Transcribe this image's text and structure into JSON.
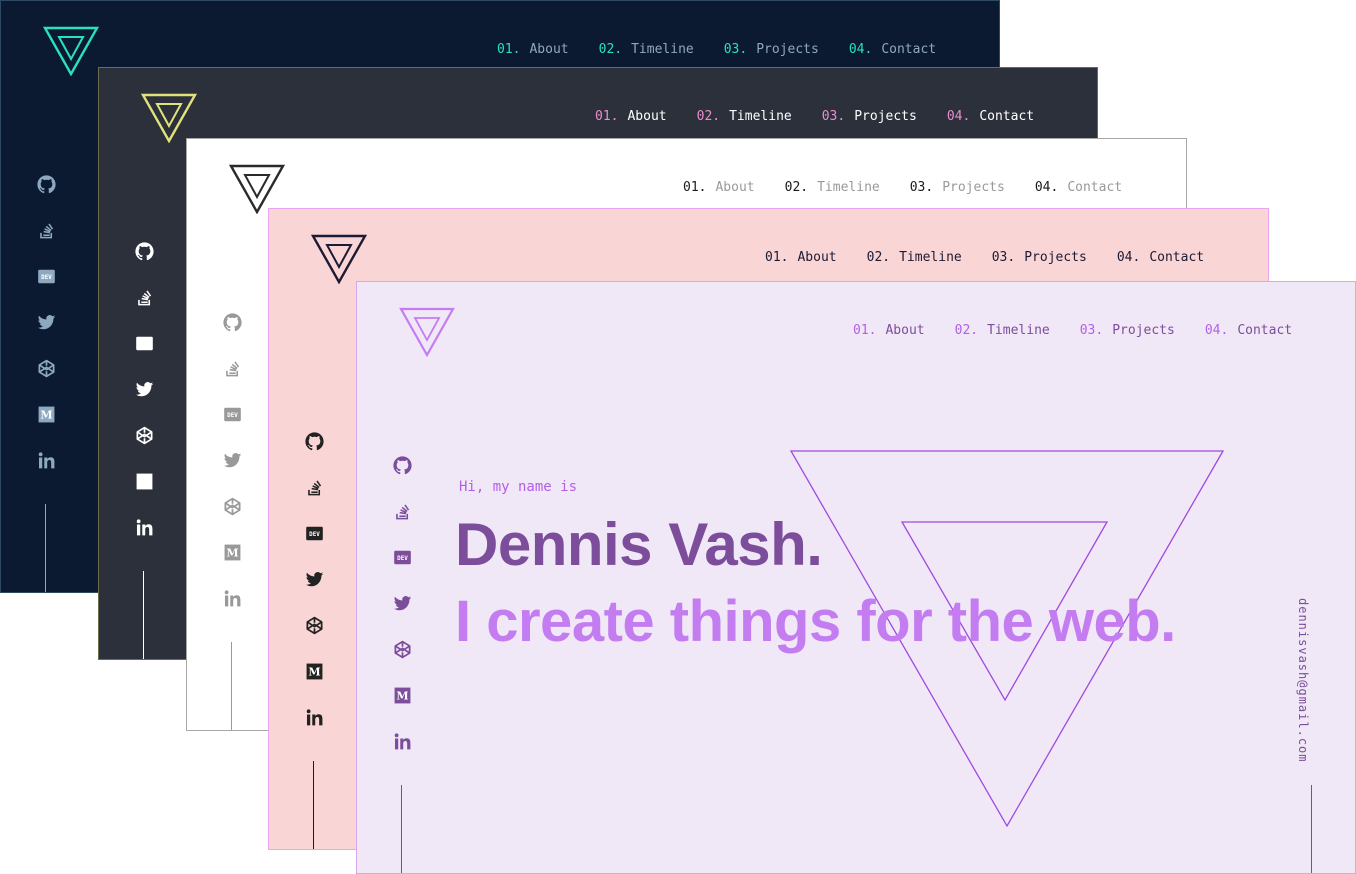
{
  "nav": [
    {
      "num": "01.",
      "label": "About"
    },
    {
      "num": "02.",
      "label": "Timeline"
    },
    {
      "num": "03.",
      "label": "Projects"
    },
    {
      "num": "04.",
      "label": "Contact"
    }
  ],
  "social": [
    "github-icon",
    "stackoverflow-icon",
    "dev-icon",
    "twitter-icon",
    "codepen-icon",
    "medium-icon",
    "linkedin-icon"
  ],
  "themes": {
    "navy": {
      "background": "#0b1a30",
      "accent": "#29e0c0",
      "text": "#8ea8c0",
      "icon": "#8ea8c0"
    },
    "slate": {
      "background": "#2c303a",
      "accent": "#e2e27c",
      "number": "#e98ed0",
      "text": "#ffffff",
      "icon": "#ffffff"
    },
    "white": {
      "background": "#ffffff",
      "accent": "#2a2a2a",
      "number": "#1a1a1a",
      "text": "#999999",
      "icon": "#999999"
    },
    "pink": {
      "background": "#f9d5d6",
      "accent": "#1d1a33",
      "number": "#1d1a33",
      "text": "#1d1a33",
      "icon": "#222222"
    },
    "lavender": {
      "background": "#f1e8f7",
      "accent": "#c47cf1",
      "number": "#b35fe6",
      "text": "#7b4d9a",
      "icon": "#7b4d9a"
    }
  },
  "hero": {
    "greeting": "Hi, my name is",
    "name": "Dennis Vash.",
    "tagline": "I create things for the web."
  },
  "email": "dennisvash@gmail.com"
}
